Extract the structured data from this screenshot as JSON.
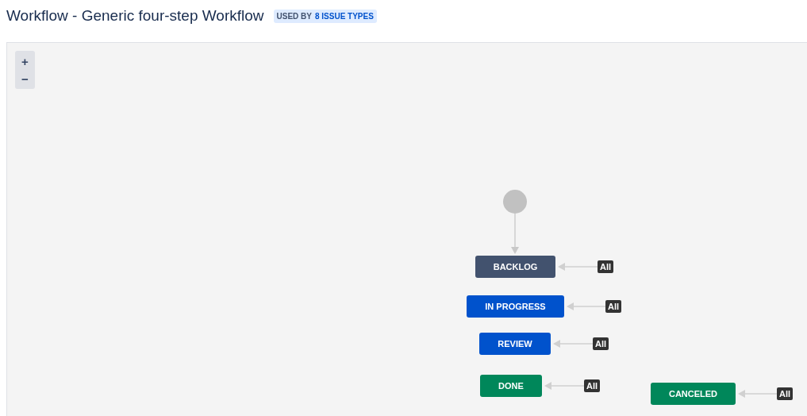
{
  "title": "Workflow - Generic four-step Workflow",
  "usage": {
    "prefix": "USED BY",
    "link": "8 ISSUE TYPES"
  },
  "zoom_controls": [
    "+",
    "−"
  ],
  "statuses": [
    {
      "label": "BACKLOG",
      "color": "#42526e",
      "global_transition": "All"
    },
    {
      "label": "IN PROGRESS",
      "color": "#0052cc",
      "global_transition": "All"
    },
    {
      "label": "REVIEW",
      "color": "#0052cc",
      "global_transition": "All"
    },
    {
      "label": "DONE",
      "color": "#00875a",
      "global_transition": "All"
    },
    {
      "label": "CANCELED",
      "color": "#00875a",
      "global_transition": "All"
    }
  ]
}
